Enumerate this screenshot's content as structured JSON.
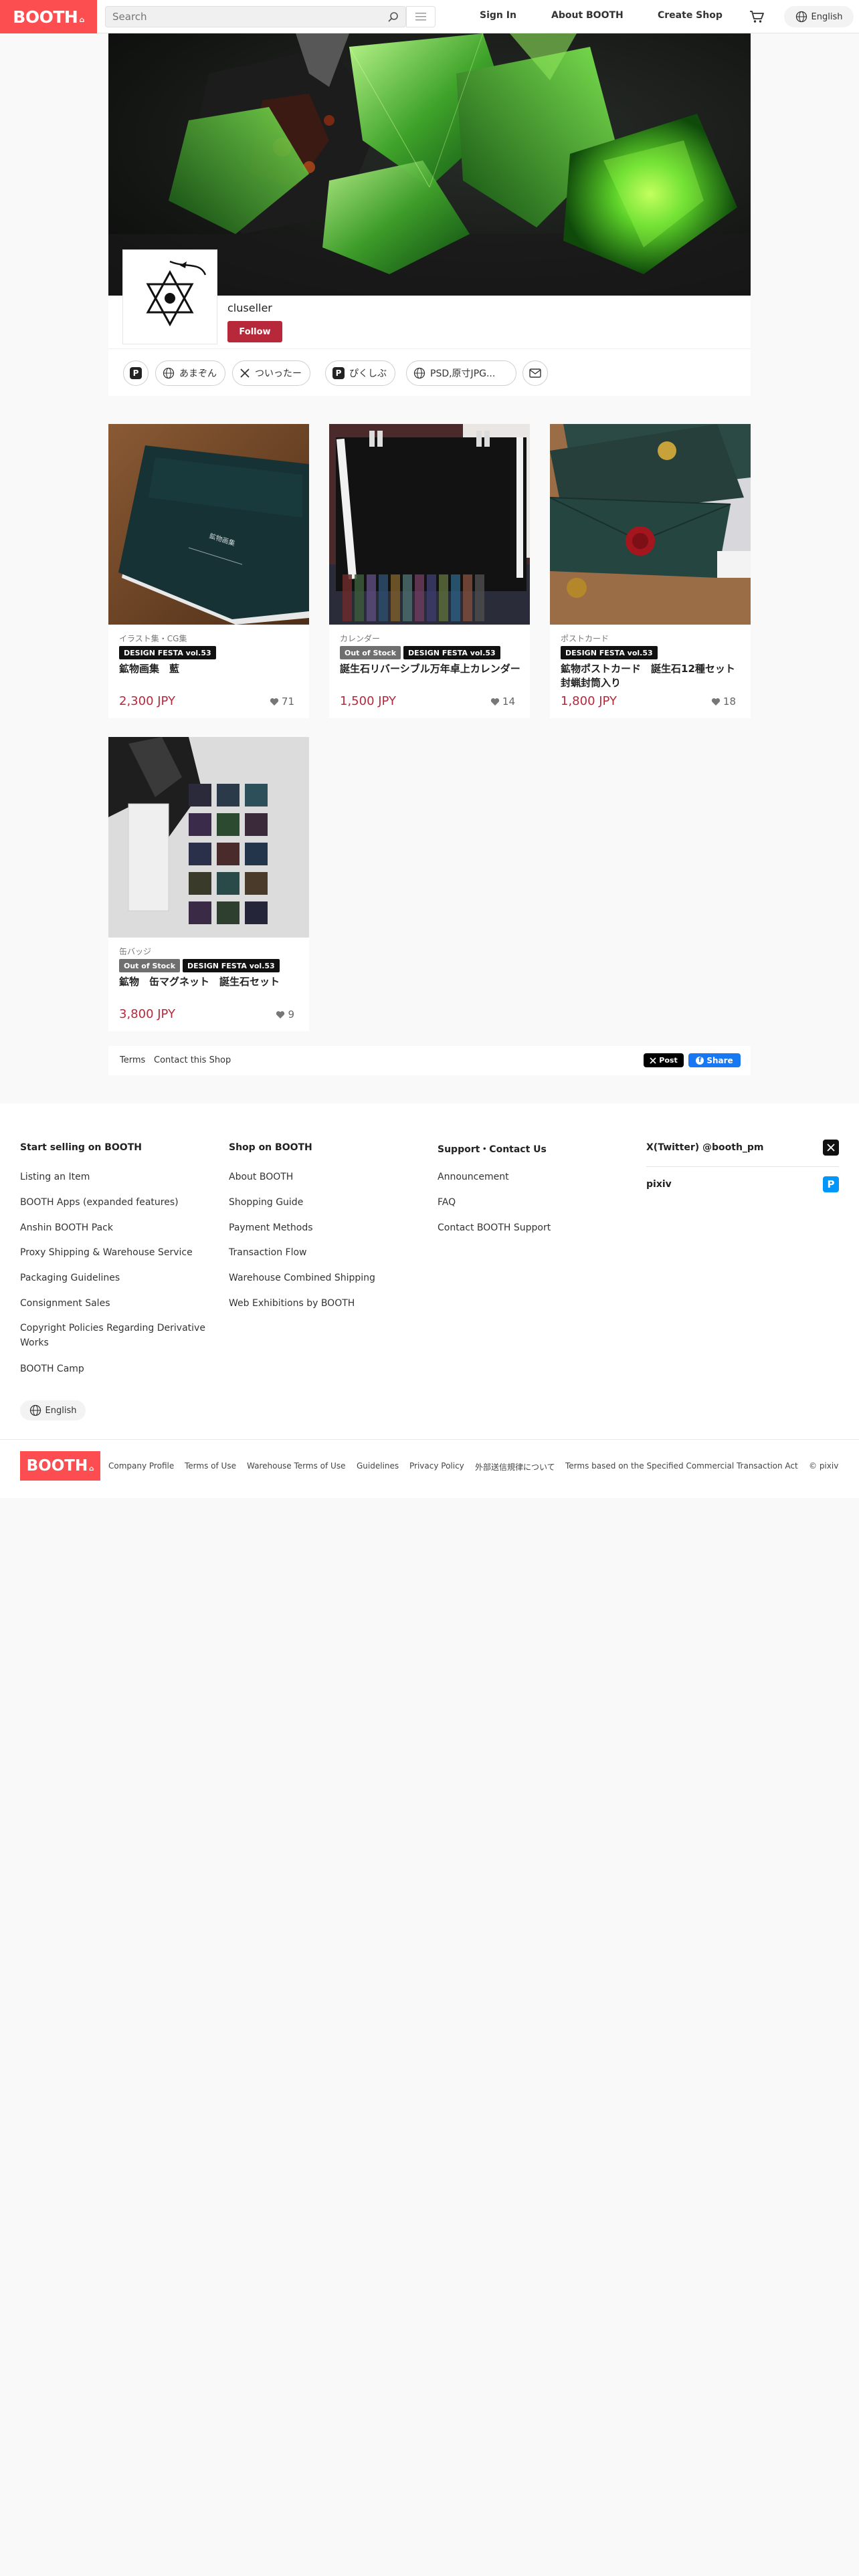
{
  "header": {
    "logo": "BOOTH",
    "search_placeholder": "Search",
    "nav": [
      "Sign In",
      "About BOOTH",
      "Create Shop"
    ],
    "language": "English"
  },
  "shop": {
    "name": "cluseller",
    "follow_label": "Follow",
    "links": [
      "あまぞん",
      "ついったー",
      "ぴくしぶ",
      "PSD,原寸JPG..."
    ]
  },
  "items": [
    {
      "category": "イラスト集・CG集",
      "badges": [
        "DESIGN FESTA vol.53"
      ],
      "out_of_stock": false,
      "title": "鉱物画集　藍",
      "price": "2,300 JPY",
      "likes": "71"
    },
    {
      "category": "カレンダー",
      "badges": [
        "Out of Stock",
        "DESIGN FESTA vol.53"
      ],
      "out_of_stock": true,
      "title": "誕生石リバーシブル万年卓上カレンダー",
      "price": "1,500 JPY",
      "likes": "14"
    },
    {
      "category": "ポストカード",
      "badges": [
        "DESIGN FESTA vol.53"
      ],
      "out_of_stock": false,
      "title": "鉱物ポストカード　誕生石12種セット　封蝋封筒入り",
      "price": "1,800 JPY",
      "likes": "18"
    },
    {
      "category": "缶バッジ",
      "badges": [
        "Out of Stock",
        "DESIGN FESTA vol.53"
      ],
      "out_of_stock": true,
      "title": "鉱物　缶マグネット　誕生石セット",
      "price": "3,800 JPY",
      "likes": "9"
    }
  ],
  "share": {
    "terms": "Terms",
    "contact": "Contact this Shop",
    "post": "Post",
    "share": "Share"
  },
  "footer": {
    "columns": [
      {
        "heading": "Start selling on BOOTH",
        "links": [
          "Listing an Item",
          "BOOTH Apps (expanded features)",
          "Anshin BOOTH Pack",
          "Proxy Shipping & Warehouse Service",
          "Packaging Guidelines",
          "Consignment Sales",
          "Copyright Policies Regarding Derivative Works",
          "BOOTH Camp"
        ]
      },
      {
        "heading": "Shop on BOOTH",
        "links": [
          "About BOOTH",
          "Shopping Guide",
          "Payment Methods",
          "Transaction Flow",
          "Warehouse Combined Shipping",
          "Web Exhibitions by BOOTH"
        ]
      },
      {
        "heading": "Support・Contact Us",
        "links": [
          "Announcement",
          "FAQ",
          "Contact BOOTH Support"
        ]
      }
    ],
    "social": [
      "X(Twitter) @booth_pm",
      "pixiv"
    ],
    "language": "English",
    "logo": "BOOTH",
    "legal": [
      "Company Profile",
      "Terms of Use",
      "Warehouse Terms of Use",
      "Guidelines",
      "Privacy Policy",
      "外部送信規律について",
      "Terms based on the Specified Commercial Transaction Act",
      "© pixiv"
    ]
  },
  "colors": {
    "brand": "#fc4d50",
    "accent": "#b7283b",
    "facebook": "#1877f2"
  }
}
